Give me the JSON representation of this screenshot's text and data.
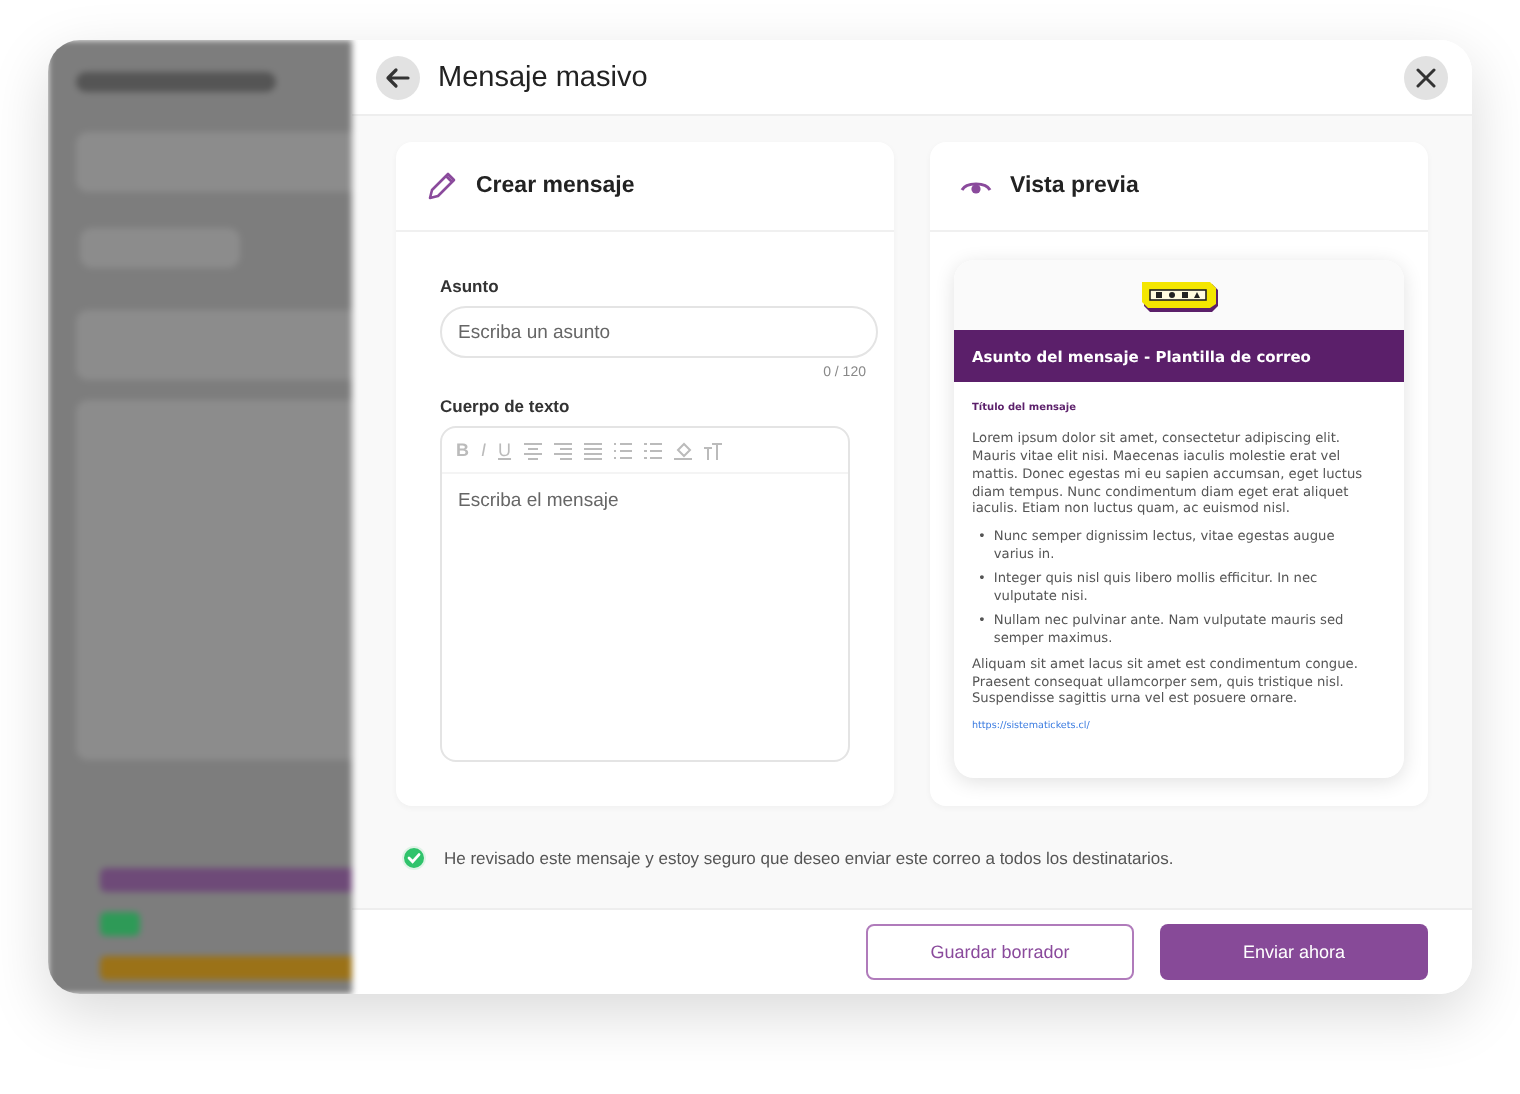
{
  "modal": {
    "title": "Mensaje masivo"
  },
  "compose": {
    "title": "Crear mensaje",
    "subject_label": "Asunto",
    "subject_placeholder": "Escriba un asunto",
    "counter": "0 / 120",
    "body_label": "Cuerpo de texto",
    "body_placeholder": "Escriba el mensaje",
    "toolbar": [
      {
        "kind": "bold",
        "label": "B"
      },
      {
        "kind": "italic",
        "label": "I"
      },
      {
        "kind": "underline",
        "label": "U"
      },
      {
        "kind": "align-center"
      },
      {
        "kind": "align-right"
      },
      {
        "kind": "justify"
      },
      {
        "kind": "bullet-list"
      },
      {
        "kind": "numbered-list"
      },
      {
        "kind": "fill"
      },
      {
        "kind": "text-size"
      }
    ]
  },
  "preview": {
    "title": "Vista previa",
    "email_subject": "Asunto del mensaje - Plantilla de correo",
    "email_heading": "Título del mensaje",
    "paragraphs": [
      "Lorem ipsum dolor sit amet, consectetur adipiscing elit. Mauris vitae elit nisi. Maecenas iaculis molestie erat vel mattis. Donec egestas mi eu sapien accumsan, eget luctus diam tempus. Nunc condimentum diam eget erat aliquet iaculis. Etiam non luctus quam, ac euismod nisl."
    ],
    "bullets": [
      {
        "marker": "•",
        "text": "Nunc semper dignissim lectus, vitae egestas augue varius in."
      },
      {
        "marker": "•",
        "text": "Integer quis nisl quis libero mollis efficitur. In nec vulputate nisi."
      },
      {
        "marker": "•",
        "text": "Nullam nec pulvinar ante. Nam vulputate mauris sed semper maximus."
      }
    ],
    "closing": "Aliquam sit amet lacus sit amet est condimentum congue. Praesent consequat ullamcorper sem, quis tristique nisl. Suspendisse sagittis urna vel est posuere ornare.",
    "link": "https://sistematickets.cl/"
  },
  "confirm": {
    "checked": true,
    "label": "He revisado este mensaje y estoy seguro que deseo enviar este correo a todos los destinatarios."
  },
  "buttons": [
    {
      "kind": "secondary",
      "label": "Guardar borrador"
    },
    {
      "kind": "primary",
      "label": "Enviar ahora"
    }
  ]
}
